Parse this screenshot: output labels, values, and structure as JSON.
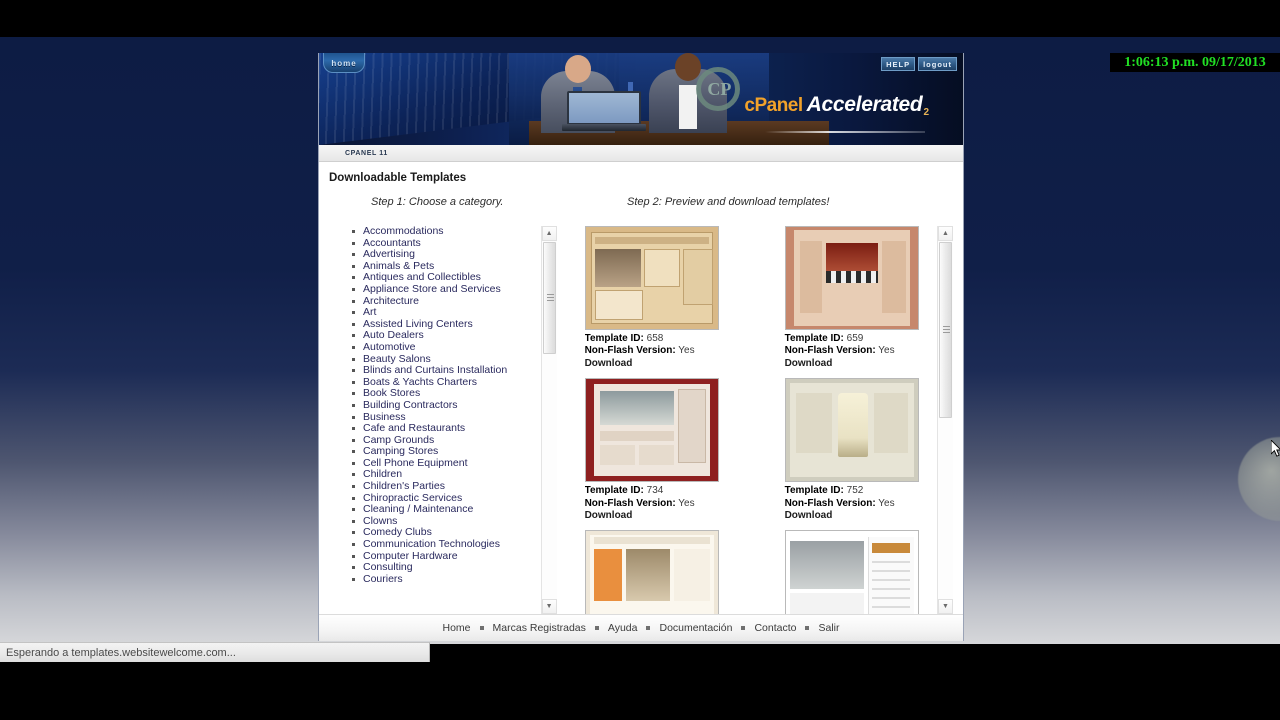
{
  "desktop": {
    "clock": "1:06:13 p.m. 09/17/2013",
    "status_text": "Esperando a templates.websitewelcome.com..."
  },
  "header": {
    "home_label": "home",
    "help_label": "HELP",
    "logout_label": "logout",
    "logo_cp": "cPanel",
    "logo_accelerated": "Accelerated",
    "logo_version": "2",
    "sub_strip_label": "CPANEL 11"
  },
  "main": {
    "title": "Downloadable Templates",
    "step1": "Step 1: Choose a category.",
    "step2": "Step 2: Preview and download templates!"
  },
  "categories": [
    "Accommodations",
    "Accountants",
    "Advertising",
    "Animals & Pets",
    "Antiques and Collectibles",
    "Appliance Store and Services",
    "Architecture",
    "Art",
    "Assisted Living Centers",
    "Auto Dealers",
    "Automotive",
    "Beauty Salons",
    "Blinds and Curtains Installation",
    "Boats & Yachts Charters",
    "Book Stores",
    "Building Contractors",
    "Business",
    "Cafe and Restaurants",
    "Camp Grounds",
    "Camping Stores",
    "Cell Phone Equipment",
    "Children",
    "Children's Parties",
    "Chiropractic Services",
    "Cleaning / Maintenance",
    "Clowns",
    "Comedy Clubs",
    "Communication Technologies",
    "Computer Hardware",
    "Consulting",
    "Couriers"
  ],
  "templates": {
    "id_label": "Template ID:",
    "nonflash_label": "Non-Flash Version:",
    "download_label": "Download",
    "items": [
      {
        "id": "658",
        "nonflash": "Yes",
        "art": "a658"
      },
      {
        "id": "659",
        "nonflash": "Yes",
        "art": "a659"
      },
      {
        "id": "734",
        "nonflash": "Yes",
        "art": "a734"
      },
      {
        "id": "752",
        "nonflash": "Yes",
        "art": "a752"
      },
      {
        "id": "",
        "nonflash": "",
        "art": "a3a"
      },
      {
        "id": "",
        "nonflash": "",
        "art": "a3b"
      }
    ]
  },
  "footer": {
    "links": [
      "Home",
      "Marcas Registradas",
      "Ayuda",
      "Documentación",
      "Contacto",
      "Salir"
    ]
  },
  "colors": {
    "desktop_navy": "#0d1c44",
    "clock_green": "#21e024",
    "link_navy": "#2a2a5e",
    "logo_orange": "#f2a22a"
  }
}
